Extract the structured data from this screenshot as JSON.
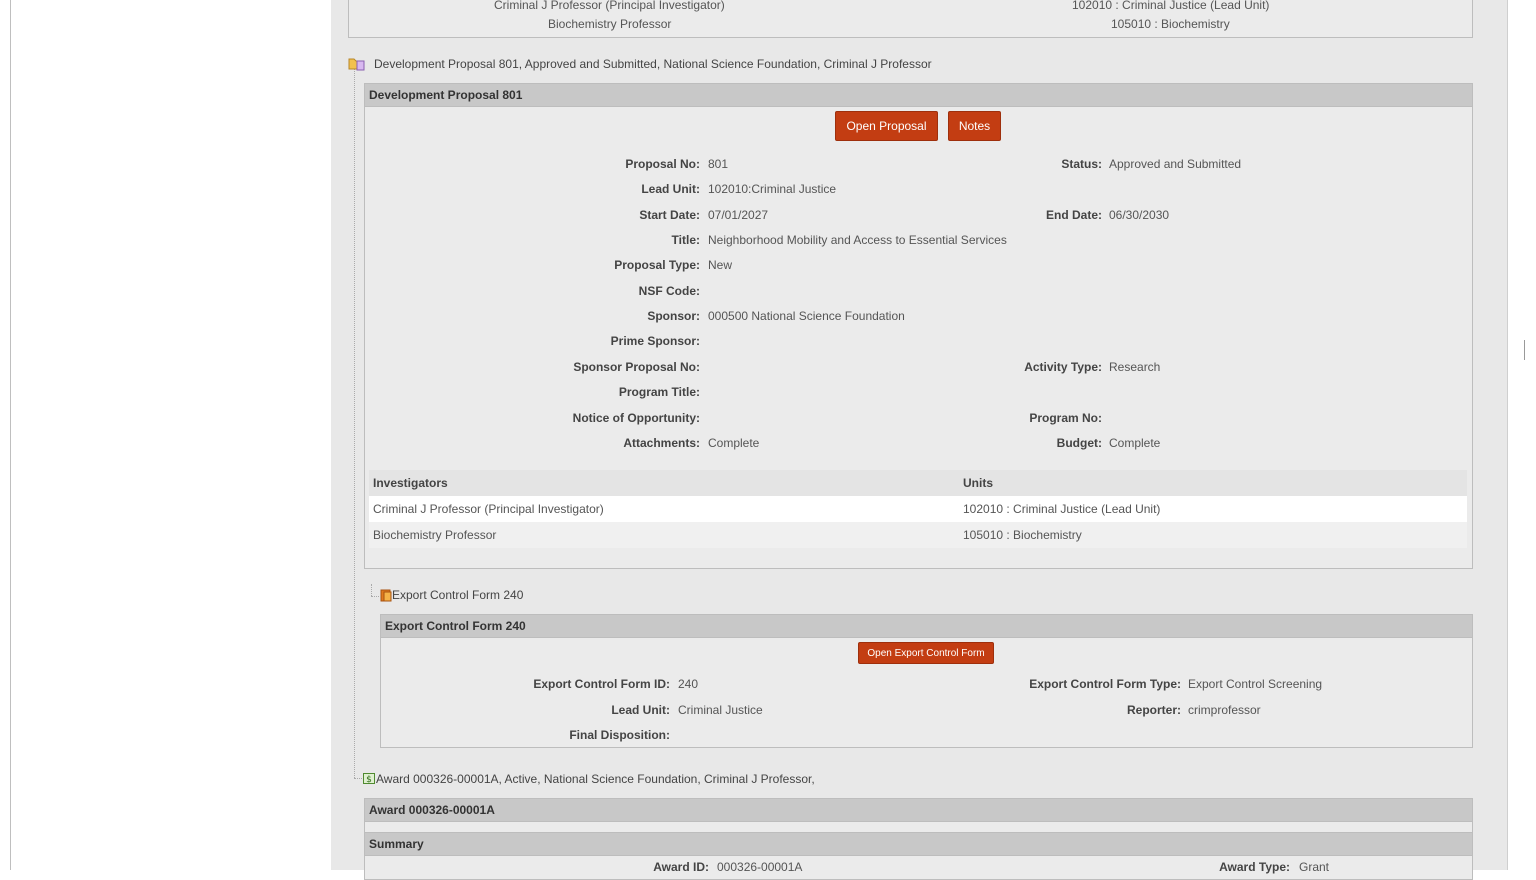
{
  "previous": {
    "row1": {
      "investigator": "Criminal J Professor (Principal Investigator)",
      "unit": "102010 : Criminal Justice (Lead Unit)"
    },
    "row2": {
      "investigator": "Biochemistry Professor",
      "unit": "105010 : Biochemistry"
    }
  },
  "proposal": {
    "tree_label": "Development Proposal 801, Approved and Submitted, National Science Foundation, Criminal J Professor",
    "header": "Development Proposal 801",
    "open_button": "Open Proposal",
    "notes_button": "Notes",
    "fields": {
      "proposal_no_label": "Proposal No:",
      "proposal_no": "801",
      "status_label": "Status:",
      "status": "Approved and Submitted",
      "lead_unit_label": "Lead Unit:",
      "lead_unit": "102010:Criminal Justice",
      "start_date_label": "Start Date:",
      "start_date": "07/01/2027",
      "end_date_label": "End Date:",
      "end_date": "06/30/2030",
      "title_label": "Title:",
      "title": "Neighborhood Mobility and Access to Essential Services",
      "proposal_type_label": "Proposal Type:",
      "proposal_type": "New",
      "nsf_code_label": "NSF Code:",
      "nsf_code": "",
      "sponsor_label": "Sponsor:",
      "sponsor": "000500 National Science Foundation",
      "prime_sponsor_label": "Prime Sponsor:",
      "prime_sponsor": "",
      "sponsor_proposal_no_label": "Sponsor Proposal No:",
      "sponsor_proposal_no": "",
      "activity_type_label": "Activity Type:",
      "activity_type": "Research",
      "program_title_label": "Program Title:",
      "program_title": "",
      "notice_label": "Notice of Opportunity:",
      "notice": "",
      "program_no_label": "Program No:",
      "program_no": "",
      "attachments_label": "Attachments:",
      "attachments": "Complete",
      "budget_label": "Budget:",
      "budget": "Complete"
    },
    "investigators": {
      "col_investigators": "Investigators",
      "col_units": "Units",
      "rows": [
        {
          "investigator": "Criminal J Professor (Principal Investigator)",
          "unit": "102010 : Criminal Justice (Lead Unit)"
        },
        {
          "investigator": "Biochemistry Professor",
          "unit": "105010 : Biochemistry"
        }
      ]
    }
  },
  "export_control": {
    "tree_label": "Export Control Form 240",
    "header": "Export Control Form 240",
    "open_button": "Open Export Control Form",
    "form_id_label": "Export Control Form ID:",
    "form_id": "240",
    "form_type_label": "Export Control Form Type:",
    "form_type": "Export Control Screening",
    "lead_unit_label": "Lead Unit:",
    "lead_unit": "Criminal Justice",
    "reporter_label": "Reporter:",
    "reporter": "crimprofessor",
    "final_disposition_label": "Final Disposition:",
    "final_disposition": ""
  },
  "award": {
    "tree_label": "Award 000326-00001A, Active, National Science Foundation, Criminal J Professor,",
    "header": "Award 000326-00001A",
    "summary_header": "Summary",
    "award_id_label": "Award ID:",
    "award_id": "000326-00001A",
    "award_type_label": "Award Type:",
    "award_type": "Grant"
  },
  "colors": {
    "button": "#c33d12",
    "panel_header": "#c8c8c8",
    "content_bg": "#e8e8e8"
  }
}
